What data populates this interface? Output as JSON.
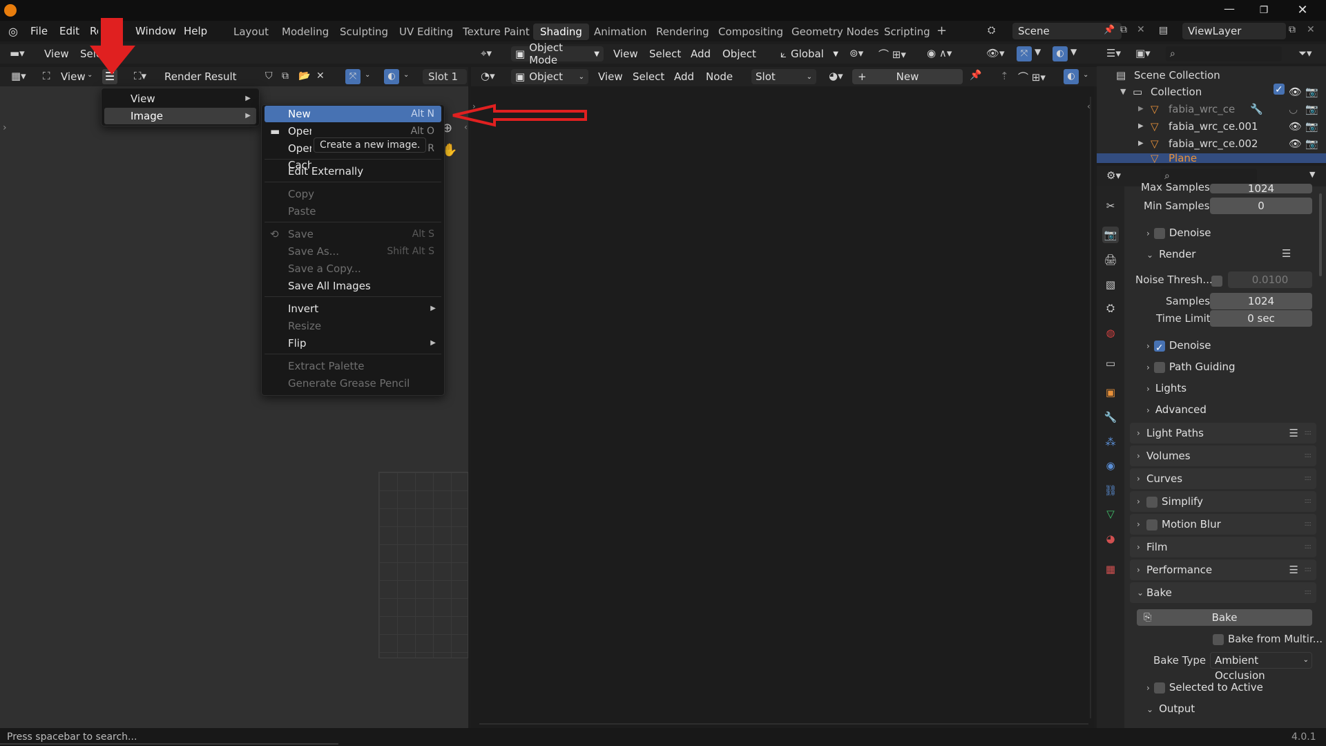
{
  "app": {
    "top_menu": [
      "File",
      "Edit",
      "Render",
      "Window",
      "Help"
    ],
    "workspace_tabs": [
      "Layout",
      "Modeling",
      "Sculpting",
      "UV Editing",
      "Texture Paint",
      "Shading",
      "Animation",
      "Rendering",
      "Compositing",
      "Geometry Nodes",
      "Scripting"
    ],
    "active_tab": "Shading",
    "scene": "Scene",
    "view_layer": "ViewLayer",
    "version": "4.0.1"
  },
  "viewport_header": {
    "menus": [
      "View",
      "Select"
    ],
    "mode": "Object Mode",
    "items": [
      "View",
      "Select",
      "Add",
      "Object"
    ],
    "orientation": "Global"
  },
  "image_editor": {
    "view": "View",
    "image_name": "Render Result",
    "slot": "Slot 1"
  },
  "node_editor": {
    "type": "Object",
    "menus": [
      "View",
      "Select",
      "Add",
      "Node"
    ],
    "slot": "Slot",
    "new": "New"
  },
  "context_menu": {
    "items": [
      {
        "label": "View",
        "submenu": true
      },
      {
        "label": "Image",
        "submenu": true,
        "highlighted": true
      }
    ]
  },
  "image_menu": {
    "items": [
      {
        "label": "New",
        "shortcut": "Alt N",
        "highlighted": true
      },
      {
        "label": "Open...",
        "shortcut": "Alt O"
      },
      {
        "label": "Open Cache...",
        "shortcut": "R"
      },
      {
        "label": "Edit Externally"
      },
      {
        "label": "Copy",
        "disabled": true
      },
      {
        "label": "Paste",
        "disabled": true
      },
      {
        "label": "Save",
        "shortcut": "Alt S",
        "disabled": true
      },
      {
        "label": "Save As...",
        "shortcut": "Shift Alt S",
        "disabled": true
      },
      {
        "label": "Save a Copy...",
        "disabled": true
      },
      {
        "label": "Save All Images"
      },
      {
        "label": "Invert",
        "submenu": true
      },
      {
        "label": "Resize",
        "disabled": true
      },
      {
        "label": "Flip",
        "submenu": true
      },
      {
        "label": "Extract Palette",
        "disabled": true
      },
      {
        "label": "Generate Grease Pencil",
        "disabled": true
      }
    ],
    "tooltip": "Create a new image."
  },
  "outliner": {
    "root": "Scene Collection",
    "collection": "Collection",
    "objects": [
      "fabia_wrc_ce",
      "fabia_wrc_ce.001",
      "fabia_wrc_ce.002",
      "Plane"
    ]
  },
  "properties": {
    "max_samples_label": "Max Samples",
    "max_samples": "1024",
    "min_samples_label": "Min Samples",
    "min_samples": "0",
    "denoise_label": "Denoise",
    "render_label": "Render",
    "noise_thresh_label": "Noise Thresh...",
    "noise_thresh": "0.0100",
    "samples_label": "Samples",
    "samples": "1024",
    "time_limit_label": "Time Limit",
    "time_limit": "0 sec",
    "denoise2_label": "Denoise",
    "path_guiding_label": "Path Guiding",
    "lights_label": "Lights",
    "advanced_label": "Advanced",
    "sections": [
      "Light Paths",
      "Volumes",
      "Curves",
      "Simplify",
      "Motion Blur",
      "Film",
      "Performance",
      "Bake"
    ],
    "bake_button": "Bake",
    "bake_from_multires": "Bake from Multir...",
    "bake_type_label": "Bake Type",
    "bake_type": "Ambient Occlusion",
    "selected_to_active": "Selected to Active",
    "output_label": "Output"
  },
  "status": {
    "hint": "Press spacebar to search..."
  },
  "colors": {
    "accent": "#4772b3",
    "annotation_red": "#e02020"
  }
}
